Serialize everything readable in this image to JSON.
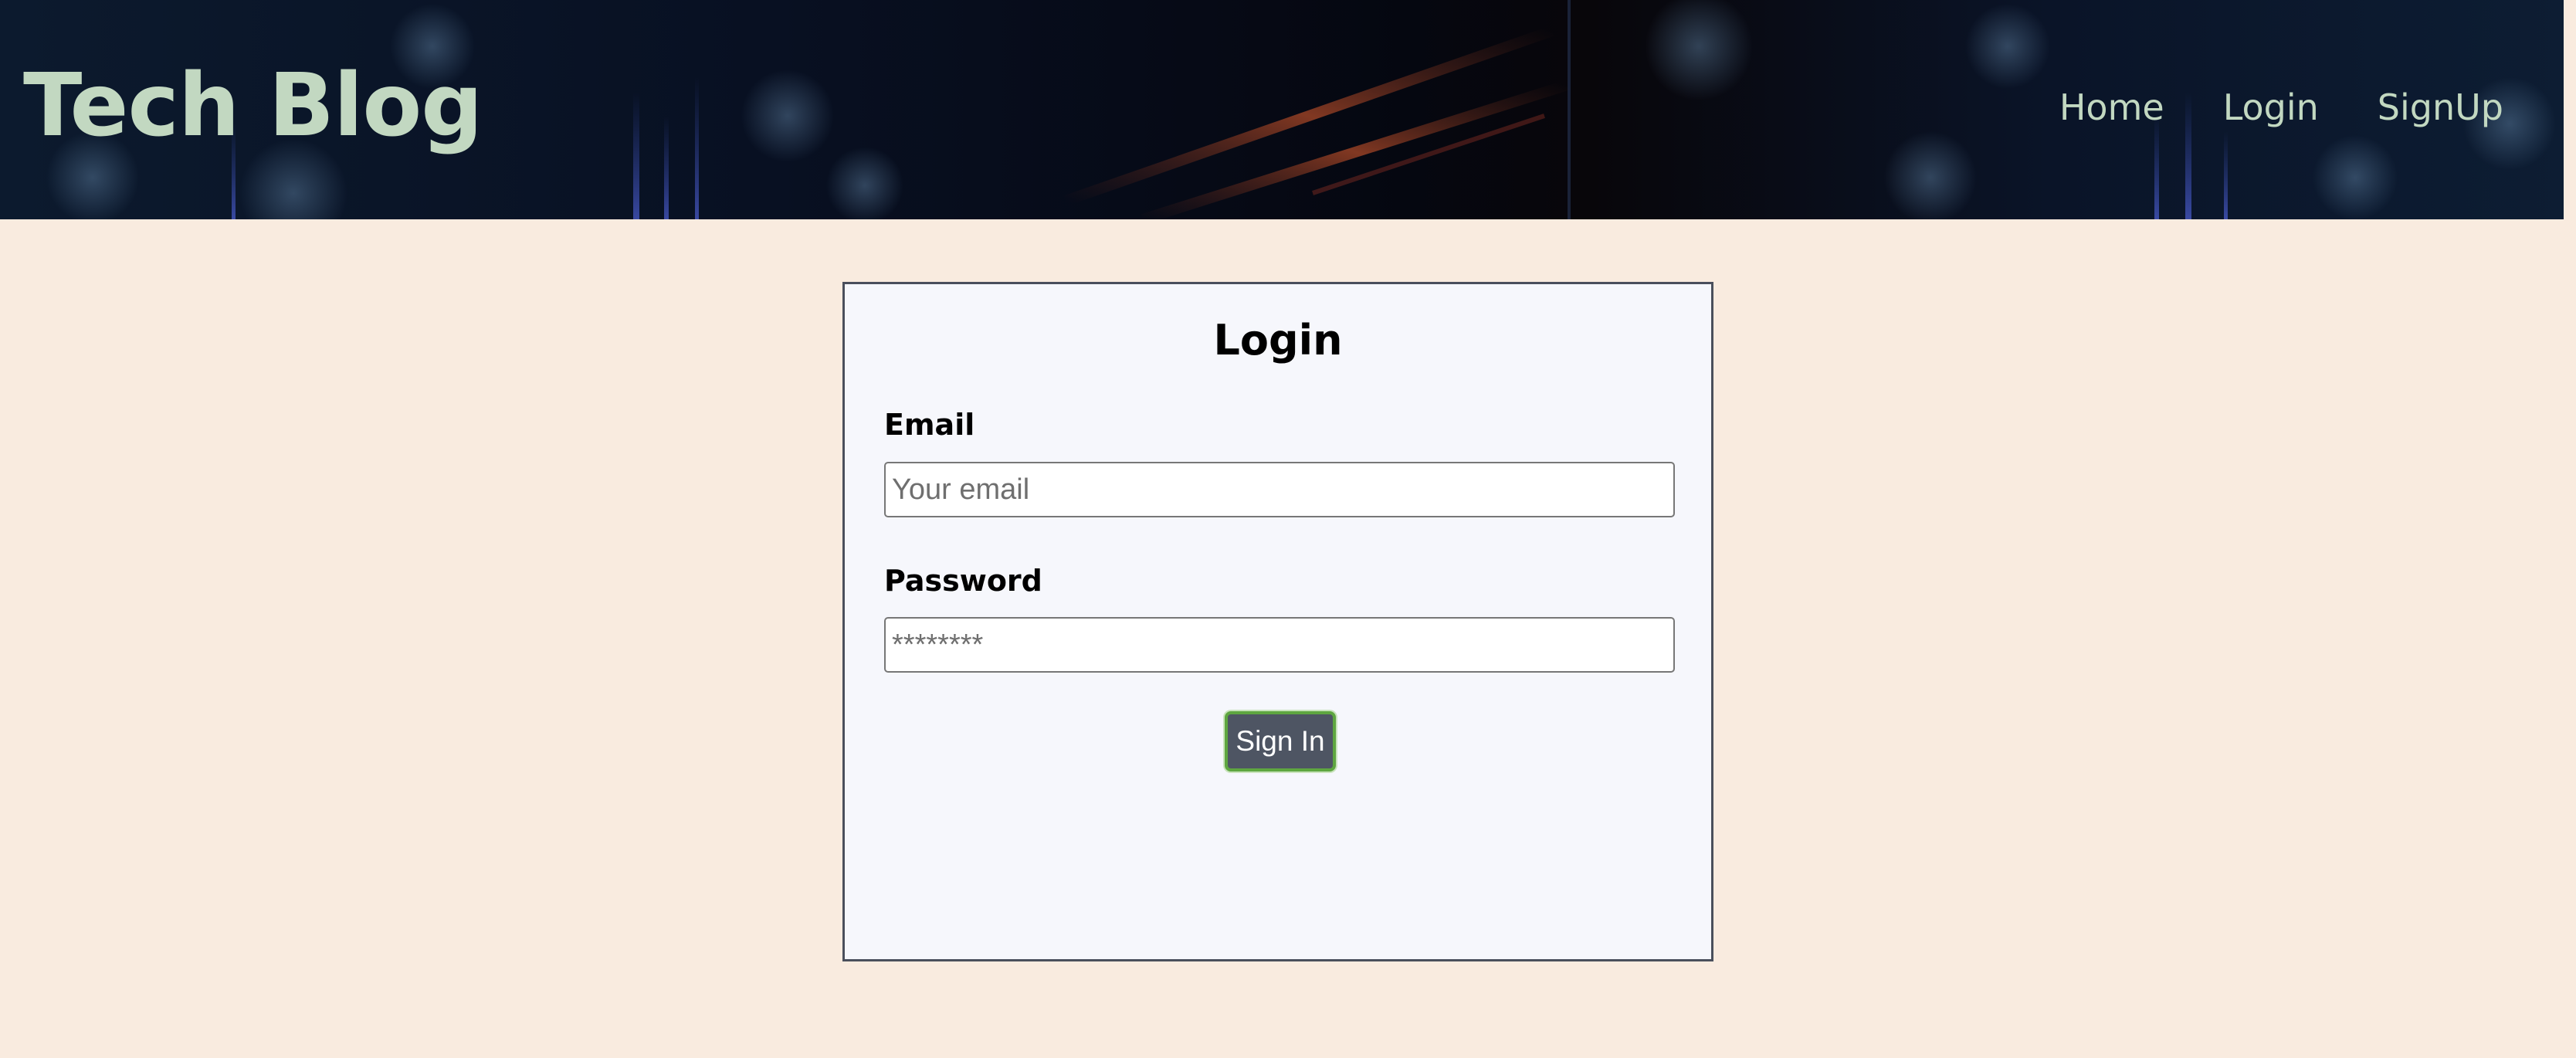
{
  "header": {
    "title": "Tech Blog",
    "nav": [
      {
        "label": "Home"
      },
      {
        "label": "Login"
      },
      {
        "label": "SignUp"
      }
    ],
    "title_color": "#c2d8c1"
  },
  "login": {
    "title": "Login",
    "email": {
      "label": "Email",
      "placeholder": "Your email",
      "value": ""
    },
    "password": {
      "label": "Password",
      "placeholder": "********",
      "value": ""
    },
    "submit_label": "Sign In"
  },
  "colors": {
    "page_background": "#f9ebdf",
    "card_background": "#f6f7fc",
    "button_background": "#4e5563",
    "button_border": "#5ea640"
  }
}
